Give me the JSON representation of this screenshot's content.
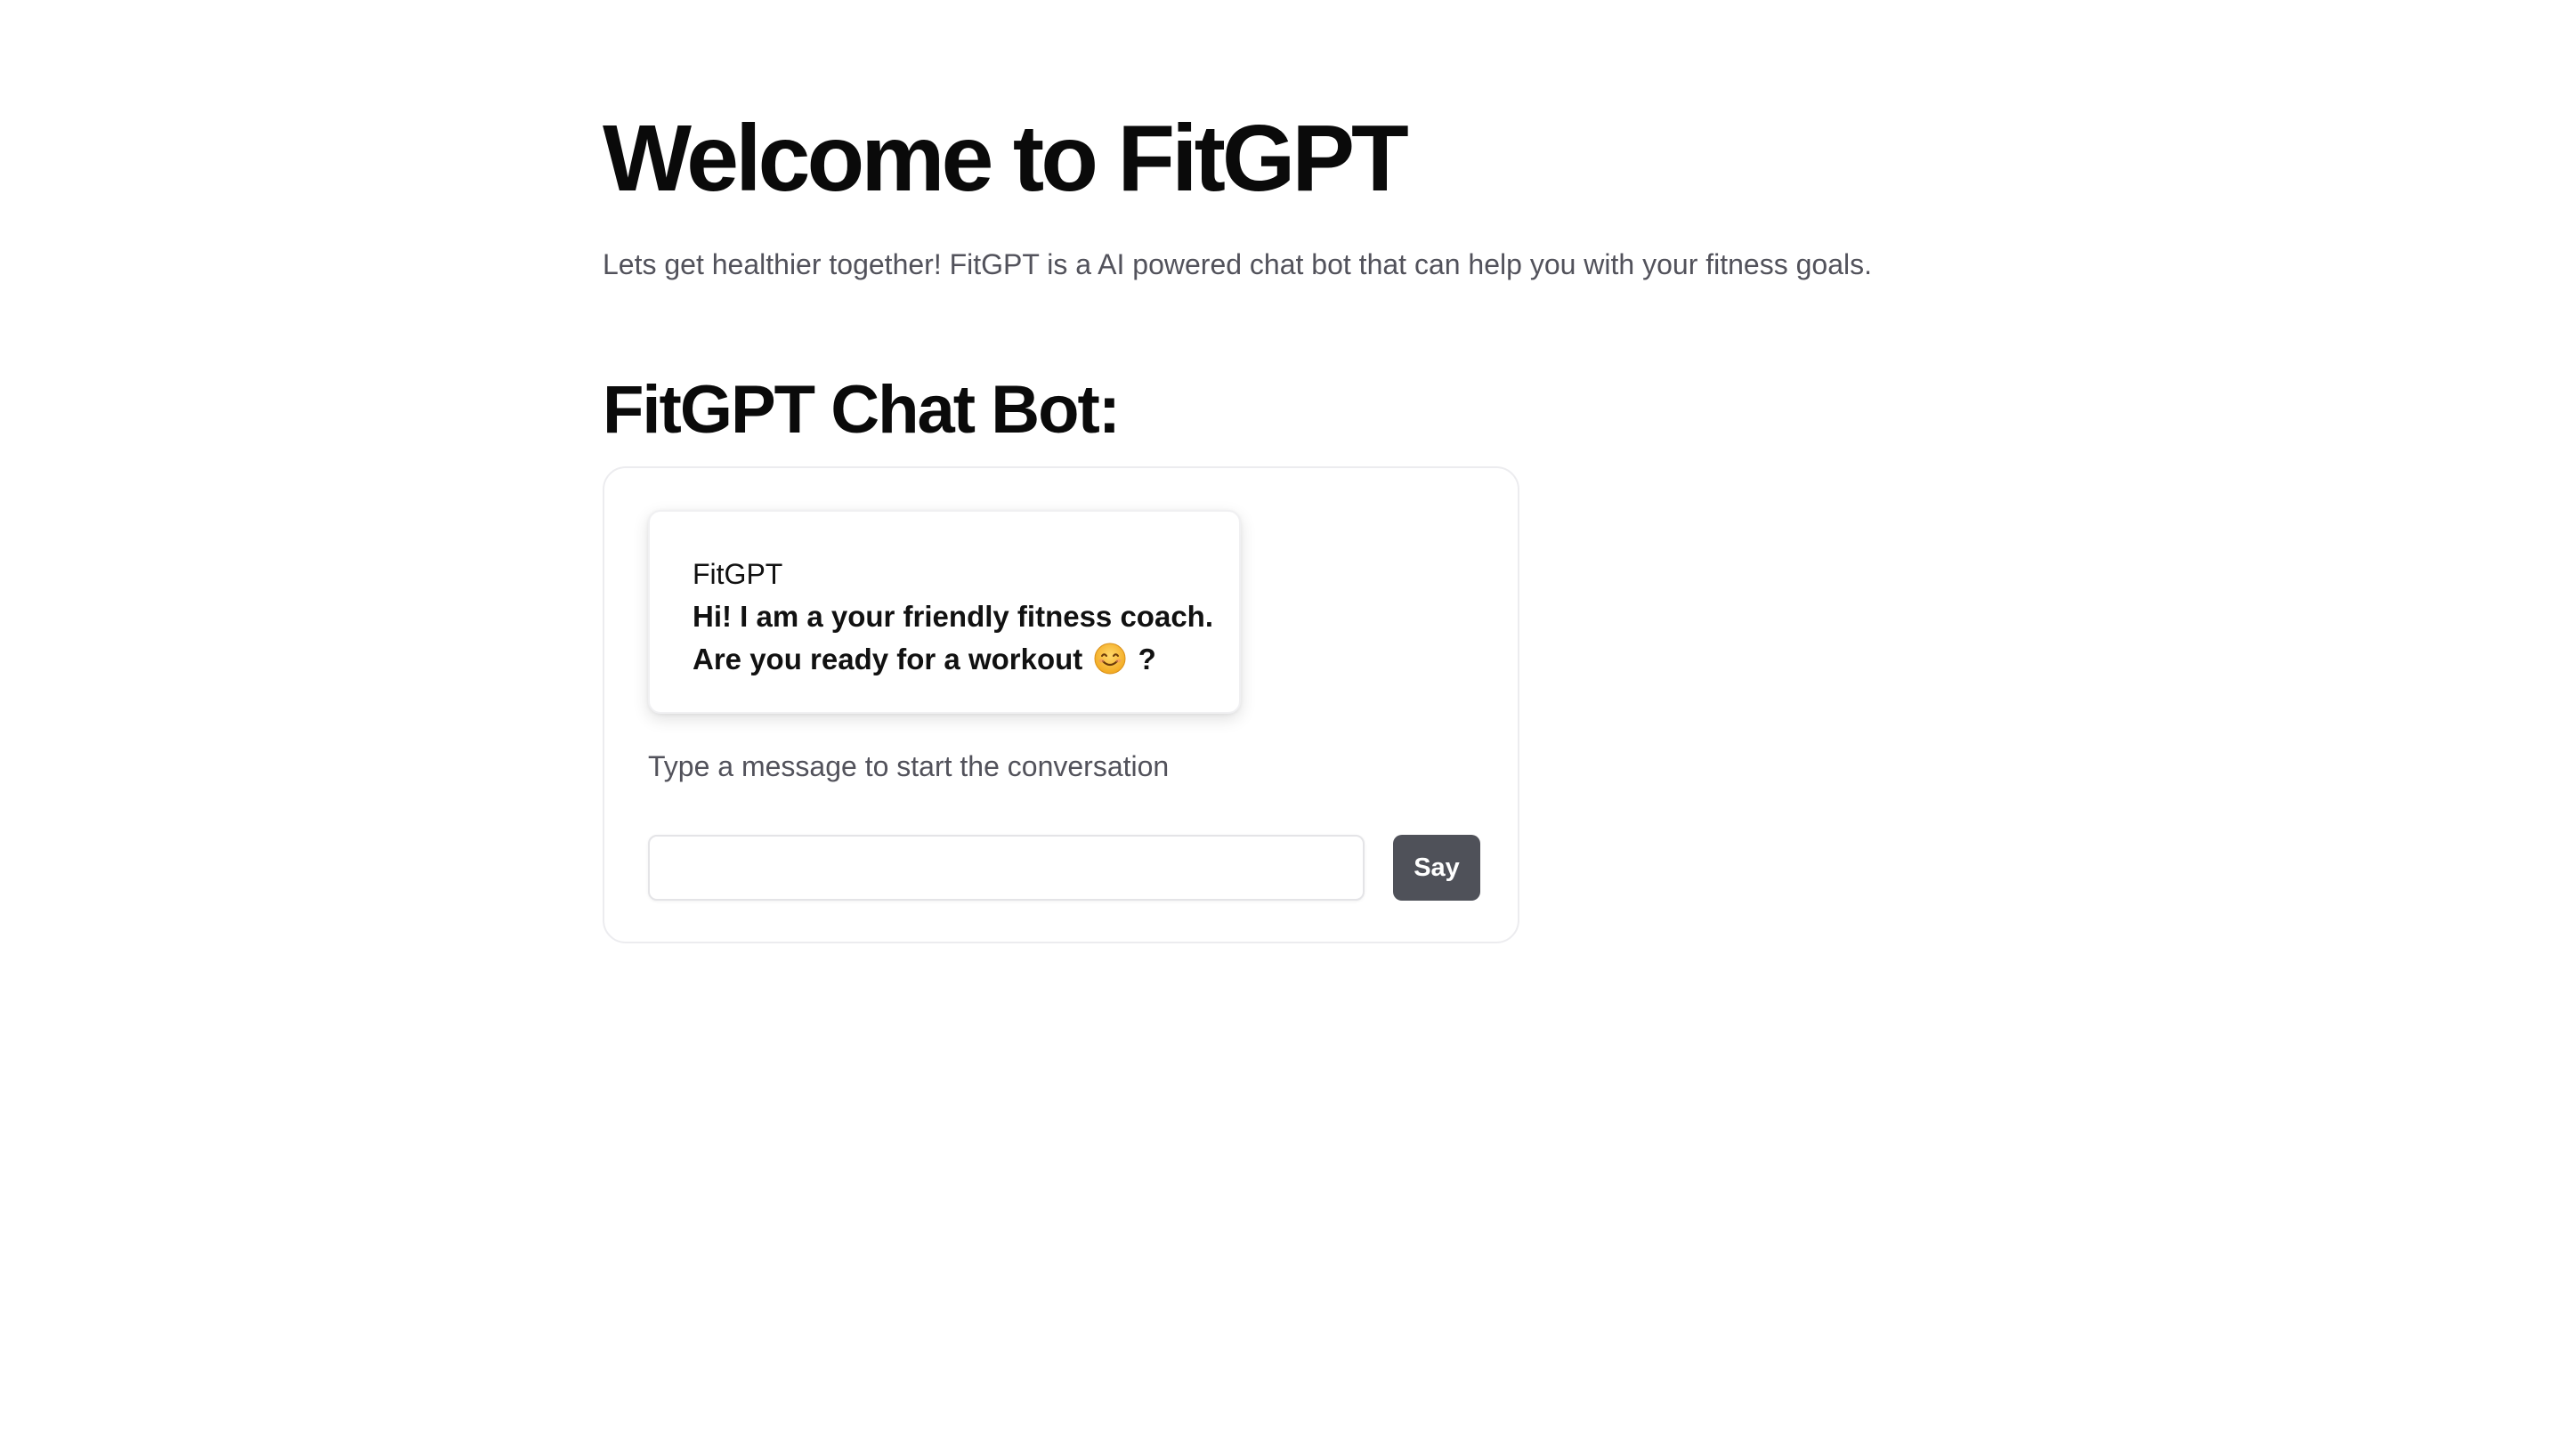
{
  "header": {
    "title": "Welcome to FitGPT",
    "subtitle": "Lets get healthier together! FitGPT is a AI powered chat bot that can help you with your fitness goals."
  },
  "chat": {
    "section_title": "FitGPT Chat Bot:",
    "messages": [
      {
        "sender": "FitGPT",
        "text_before_emoji": "Hi! I am a your friendly fitness coach. Are you ready for a workout",
        "emoji_icon": "smiling-face-emoji",
        "text_after_emoji": "?"
      }
    ],
    "hint": "Type a message to start the conversation",
    "input": {
      "value": "",
      "placeholder": ""
    },
    "send_label": "Say"
  },
  "colors": {
    "button_bg": "#4f5159",
    "muted_text": "#52525b",
    "heading_text": "#0a0a0a"
  }
}
